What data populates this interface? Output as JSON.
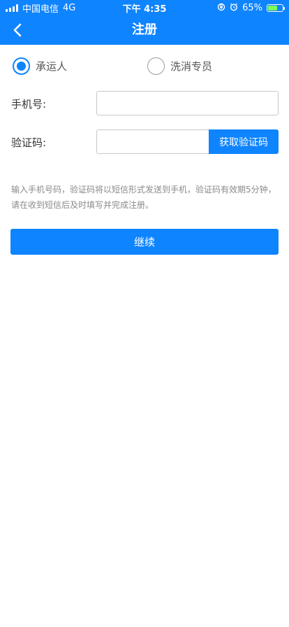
{
  "status_bar": {
    "carrier": "中国电信",
    "network": "4G",
    "time": "下午 4:35",
    "battery": "65%",
    "battery_level": 0.65
  },
  "nav": {
    "title": "注册",
    "back_icon": "chevron-left-icon"
  },
  "role_options": [
    {
      "label": "承运人",
      "checked": true
    },
    {
      "label": "洗消专员",
      "checked": false
    }
  ],
  "form": {
    "phone_label": "手机号:",
    "phone_value": "",
    "code_label": "验证码:",
    "code_value": "",
    "get_code_button": "获取验证码"
  },
  "hint": "输入手机号码，验证码将以短信形式发送到手机，验证码有效期5分钟，请在收到短信后及时填写并完成注册。",
  "continue_button": "继续",
  "colors": {
    "primary": "#0f84ff",
    "hint_text": "#8a8a8a"
  }
}
